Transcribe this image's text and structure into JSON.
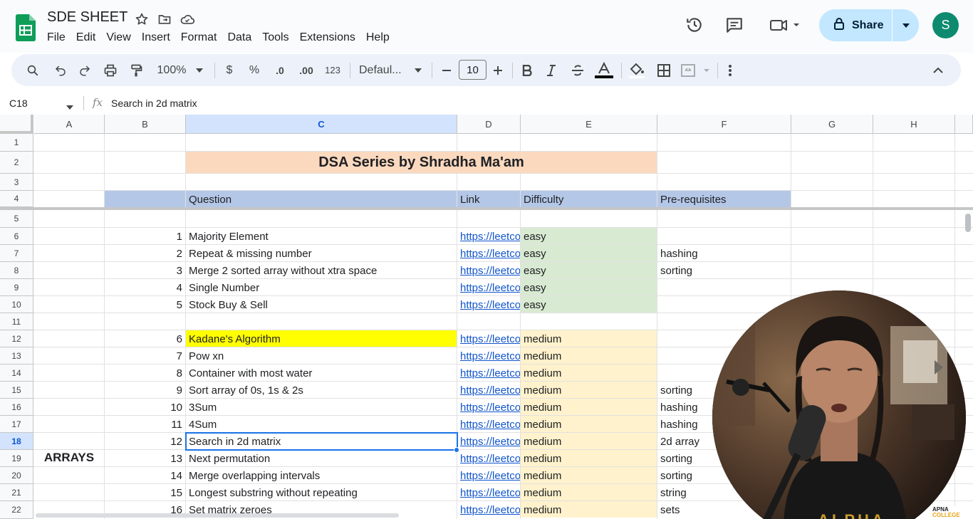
{
  "document": {
    "title": "SDE SHEET"
  },
  "menu": [
    "File",
    "Edit",
    "View",
    "Insert",
    "Format",
    "Data",
    "Tools",
    "Extensions",
    "Help"
  ],
  "share": {
    "label": "Share"
  },
  "user": {
    "avatar_initial": "S"
  },
  "toolbar": {
    "zoom": "100%",
    "currency": "$",
    "percent": "%",
    "dec_decrease": ".0",
    "dec_increase": ".00",
    "number_format": "123",
    "font": "Defaul...",
    "font_size": "10"
  },
  "formula_bar": {
    "name_box": "C18",
    "fx": "fx",
    "value": "Search in 2d matrix"
  },
  "columns": [
    "A",
    "B",
    "C",
    "D",
    "E",
    "F",
    "G",
    "H"
  ],
  "rows": [
    "1",
    "2",
    "3",
    "4",
    "5",
    "6",
    "7",
    "8",
    "9",
    "10",
    "11",
    "12",
    "13",
    "14",
    "15",
    "16",
    "17",
    "18",
    "19",
    "20",
    "21",
    "22"
  ],
  "sheet": {
    "banner": "DSA Series by Shradha Ma'am",
    "headers": {
      "question": "Question",
      "link": "Link",
      "difficulty": "Difficulty",
      "prereq": "Pre-requisites"
    },
    "section": "ARRAYS",
    "entries": [
      {
        "n": "1",
        "q": "Majority Element",
        "link": "https://leetcode",
        "diff": "easy",
        "pre": ""
      },
      {
        "n": "2",
        "q": "Repeat & missing number",
        "link": "https://leetcode",
        "diff": "easy",
        "pre": "hashing"
      },
      {
        "n": "3",
        "q": "Merge 2 sorted array without xtra space",
        "link": "https://leetcode",
        "diff": "easy",
        "pre": "sorting"
      },
      {
        "n": "4",
        "q": "Single Number",
        "link": "https://leetcode",
        "diff": "easy",
        "pre": ""
      },
      {
        "n": "5",
        "q": "Stock Buy & Sell",
        "link": "https://leetcode",
        "diff": "easy",
        "pre": ""
      },
      {
        "n": "6",
        "q": "Kadane's Algorithm",
        "link": "https://leetcode",
        "diff": "medium",
        "pre": ""
      },
      {
        "n": "7",
        "q": "Pow xn",
        "link": "https://leetcode",
        "diff": "medium",
        "pre": ""
      },
      {
        "n": "8",
        "q": "Container with most water",
        "link": "https://leetcode",
        "diff": "medium",
        "pre": ""
      },
      {
        "n": "9",
        "q": "Sort array of 0s, 1s & 2s",
        "link": "https://leetcode",
        "diff": "medium",
        "pre": "sorting"
      },
      {
        "n": "10",
        "q": "3Sum",
        "link": "https://leetcode",
        "diff": "medium",
        "pre": "hashing"
      },
      {
        "n": "11",
        "q": "4Sum",
        "link": "https://leetcode",
        "diff": "medium",
        "pre": "hashing"
      },
      {
        "n": "12",
        "q": "Search in 2d matrix",
        "link": "https://leetcode",
        "diff": "medium",
        "pre": "2d array"
      },
      {
        "n": "13",
        "q": "Next permutation",
        "link": "https://leetcode",
        "diff": "medium",
        "pre": "sorting"
      },
      {
        "n": "14",
        "q": "Merge overlapping intervals",
        "link": "https://leetcode",
        "diff": "medium",
        "pre": "sorting"
      },
      {
        "n": "15",
        "q": "Longest substring without repeating",
        "link": "https://leetcode",
        "diff": "medium",
        "pre": "string"
      },
      {
        "n": "16",
        "q": "Set matrix zeroes",
        "link": "https://leetcode",
        "diff": "medium",
        "pre": "sets"
      }
    ]
  },
  "overlay": {
    "brand_line1": "APNA",
    "brand_line2": "COLLEGE",
    "shirt_text": "ALPHA"
  },
  "colors": {
    "easy": "#d9ead3",
    "medium": "#fff2cc",
    "header": "#b4c7e7",
    "banner": "#fbd9bf",
    "highlight": "#ffff00",
    "share": "#c2e7ff",
    "avatar": "#0d8a6f"
  }
}
